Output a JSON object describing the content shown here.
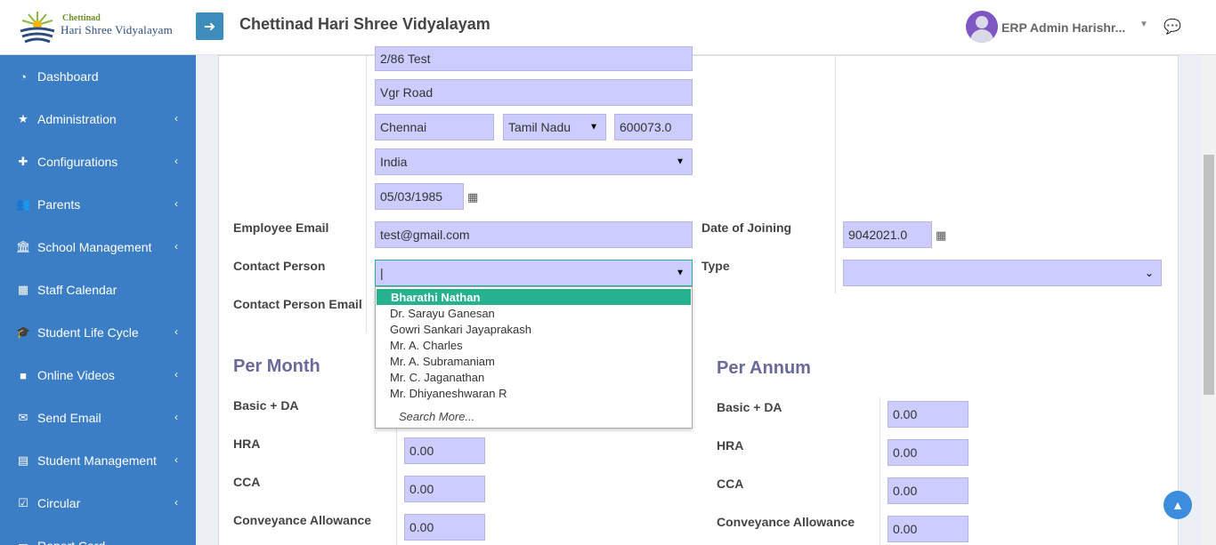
{
  "logo": {
    "top": "Chettinad",
    "bottom": "Hari Shree Vidyalayam"
  },
  "header": {
    "title": "Chettinad Hari Shree Vidyalayam",
    "user": "ERP Admin Harishr..."
  },
  "sidebar": {
    "items": [
      {
        "label": "Dashboard",
        "icon": "dashboard-icon",
        "glyph": "◔",
        "has_chevron": false
      },
      {
        "label": "Administration",
        "icon": "star-icon",
        "glyph": "★",
        "has_chevron": true
      },
      {
        "label": "Configurations",
        "icon": "puzzle-icon",
        "glyph": "✚",
        "has_chevron": true
      },
      {
        "label": "Parents",
        "icon": "users-icon",
        "glyph": "👥",
        "has_chevron": true
      },
      {
        "label": "School Management",
        "icon": "bank-icon",
        "glyph": "🏛",
        "has_chevron": true
      },
      {
        "label": "Staff Calendar",
        "icon": "calendar-icon",
        "glyph": "▦",
        "has_chevron": false
      },
      {
        "label": "Student Life Cycle",
        "icon": "graduation-cap-icon",
        "glyph": "🎓",
        "has_chevron": true
      },
      {
        "label": "Online Videos",
        "icon": "video-icon",
        "glyph": "■",
        "has_chevron": true
      },
      {
        "label": "Send Email",
        "icon": "envelope-icon",
        "glyph": "✉",
        "has_chevron": true
      },
      {
        "label": "Student Management",
        "icon": "book-icon",
        "glyph": "▤",
        "has_chevron": true
      },
      {
        "label": "Circular",
        "icon": "calendar-check-icon",
        "glyph": "☑",
        "has_chevron": true
      },
      {
        "label": "Report Card",
        "icon": "file-icon",
        "glyph": "▭",
        "has_chevron": false
      }
    ]
  },
  "form": {
    "address1": "2/86 Test",
    "address2": "Vgr Road",
    "city": "Chennai",
    "state": "Tamil Nadu",
    "pincode": "600073.0",
    "country": "India",
    "dob": "05/03/1985",
    "employee_email_label": "Employee Email",
    "employee_email": "test@gmail.com",
    "doj_label": "Date of Joining",
    "doj": "9042021.0",
    "contact_person_label": "Contact Person",
    "contact_person": "|",
    "type_label": "Type",
    "type": "",
    "contact_email_label": "Contact Person Email"
  },
  "dropdown": {
    "options": [
      "Bharathi Nathan",
      "Dr. Sarayu Ganesan",
      "Gowri Sankari Jayaprakash",
      "Mr. A. Charles",
      "Mr. A. Subramaniam",
      "Mr. C. Jaganathan",
      "Mr. Dhiyaneshwaran R"
    ],
    "more": "Search More..."
  },
  "salary": {
    "per_month_title": "Per Month",
    "per_annum_title": "Per Annum",
    "labels": {
      "basic": "Basic + DA",
      "hra": "HRA",
      "cca": "CCA",
      "conveyance": "Conveyance Allowance"
    },
    "month": {
      "hra": "0.00",
      "cca": "0.00",
      "conveyance": "0.00"
    },
    "annum": {
      "basic": "0.00",
      "hra": "0.00",
      "cca": "0.00",
      "conveyance": "0.00"
    }
  }
}
